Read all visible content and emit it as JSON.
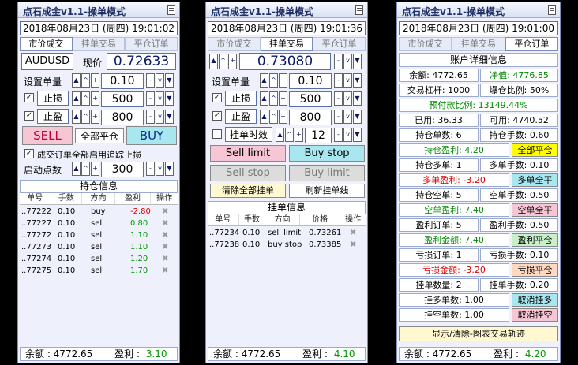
{
  "app_title": "点石成金v1.1-操单模式",
  "tabs": [
    "市价成交",
    "挂单交易",
    "平仓订单"
  ],
  "panel1": {
    "date": "2018年08月23日 (周四) 19:01:02",
    "symbol": "AUDUSD",
    "price_label": "现价",
    "price": "0.72633",
    "lot_label": "设置单量",
    "lot": "0.10",
    "sl_label": "止损",
    "sl": "500",
    "tp_label": "止盈",
    "tp": "800",
    "sell": "SELL",
    "close_all": "全部平仓",
    "buy": "BUY",
    "trail_text": "成交订单全部启用追踪止损",
    "start_label": "启动点数",
    "start": "300",
    "section": "持仓信息",
    "headers": [
      "单号",
      "手数",
      "方向",
      "盈利",
      "操作"
    ],
    "rows": [
      {
        "id": "..77222",
        "lots": "0.10",
        "dir": "buy",
        "profit": "-2.80",
        "color": "#dd0000"
      },
      {
        "id": "..77227",
        "lots": "0.10",
        "dir": "sell",
        "profit": "0.80",
        "color": "#009900"
      },
      {
        "id": "..77272",
        "lots": "0.10",
        "dir": "sell",
        "profit": "1.10",
        "color": "#009900"
      },
      {
        "id": "..77273",
        "lots": "0.10",
        "dir": "sell",
        "profit": "1.10",
        "color": "#009900"
      },
      {
        "id": "..77274",
        "lots": "0.10",
        "dir": "sell",
        "profit": "1.20",
        "color": "#009900"
      },
      {
        "id": "..77275",
        "lots": "0.10",
        "dir": "sell",
        "profit": "1.70",
        "color": "#009900"
      }
    ],
    "footer_balance": "余额 : 4772.65",
    "footer_profit_label": "盈利 :",
    "footer_profit": "3.10"
  },
  "panel2": {
    "date": "2018年08月23日 (周四) 19:01:36",
    "price": "0.73080",
    "lot_label": "设置单量",
    "lot": "0.10",
    "sl_label": "止损",
    "sl": "500",
    "tp_label": "止盈",
    "tp": "800",
    "time_label": "挂单时效",
    "time": "12",
    "sell_limit": "Sell limit",
    "buy_stop": "Buy stop",
    "sell_stop": "Sell stop",
    "buy_limit": "Buy limit",
    "clear_all": "清除全部挂单",
    "refresh": "刷新挂单线",
    "section": "挂单信息",
    "headers": [
      "单号",
      "手数",
      "方向",
      "价格",
      "操作"
    ],
    "rows": [
      {
        "id": "..77234",
        "lots": "0.10",
        "dir": "sell limit",
        "price": "0.73261"
      },
      {
        "id": "..77238",
        "lots": "0.10",
        "dir": "buy stop",
        "price": "0.73385"
      }
    ],
    "footer_balance": "余额 : 4772.65",
    "footer_profit_label": "盈利 :",
    "footer_profit": "4.10"
  },
  "panel3": {
    "date": "2018年08月23日 (周四) 19:01:00",
    "section": "账户详细信息",
    "balance": "余额: 4772.65",
    "equity": "净值: 4776.85",
    "leverage": "交易杠杆: 1000",
    "stopout": "爆仓比例: 50%",
    "prepay": "预付款比例: 13149.44%",
    "used": "已用: 36.33",
    "free": "可用: 4740.52",
    "pos_count": "持仓单数: 6",
    "pos_lots": "持仓手数: 0.60",
    "pos_profit": "持仓盈利: 4.20",
    "btn_close_all": "全部平仓",
    "long_count": "持仓多单: 1",
    "long_lots": "多单手数: 0.10",
    "long_profit": "多单盈利: -3.20",
    "btn_close_long": "多单全平",
    "short_count": "持仓空单: 5",
    "short_lots": "空单手数: 0.50",
    "short_profit": "空单盈利: 7.40",
    "btn_close_short": "空单全平",
    "win_count": "盈利订单: 5",
    "win_lots": "盈利手数: 0.50",
    "win_profit": "盈利金额: 7.40",
    "btn_close_win": "盈利平仓",
    "loss_count": "亏损订单: 1",
    "loss_lots": "亏损手数: 0.10",
    "loss_profit": "亏损金额: -3.20",
    "btn_close_loss": "亏损平仓",
    "pending_count": "挂单数量: 2",
    "pending_lots": "挂单手数: 0.20",
    "buy_pending": "挂多单数: 1.00",
    "btn_cancel_long": "取消挂多",
    "sell_pending": "挂空单数: 1.00",
    "btn_cancel_short": "取消挂空",
    "toggle": "显示/清除-图表交易轨迹",
    "footer_balance": "余额 : 4772.65",
    "footer_profit_label": "盈利 :",
    "footer_profit": "4.20"
  }
}
